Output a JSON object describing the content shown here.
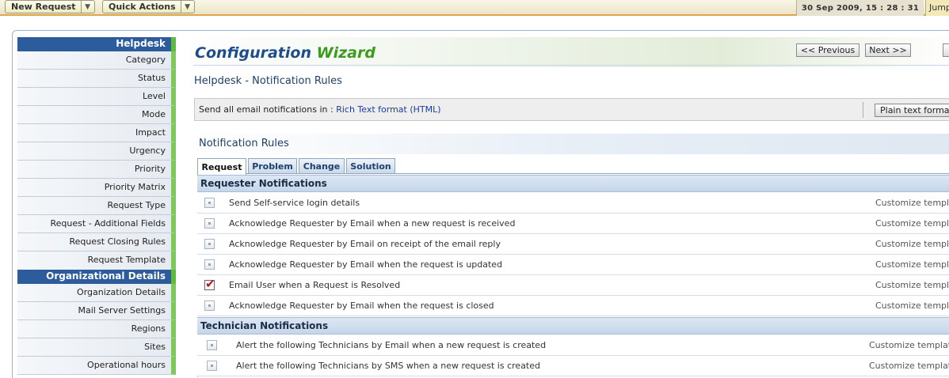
{
  "topbar": {
    "new_request": "New Request",
    "quick_actions": "Quick Actions",
    "datetime": "30 Sep 2009, 15 : 28 : 31",
    "jump": "Jump"
  },
  "sidebar": {
    "groups": [
      {
        "title": "Helpdesk",
        "items": [
          "Category",
          "Status",
          "Level",
          "Mode",
          "Impact",
          "Urgency",
          "Priority",
          "Priority Matrix",
          "Request Type",
          "Request - Additional Fields",
          "Request Closing Rules",
          "Request Template"
        ]
      },
      {
        "title": "Organizational Details",
        "items": [
          "Organization Details",
          "Mail Server Settings",
          "Regions",
          "Sites",
          "Operational hours"
        ]
      }
    ]
  },
  "wizard": {
    "title_part1": "Configuration",
    "title_part2": "Wizard",
    "prev_label": "<< Previous",
    "next_label": "Next >>"
  },
  "page_title": "Helpdesk - Notification Rules",
  "format": {
    "label": "Send all email notifications in : ",
    "value": "Rich Text format (HTML)",
    "plain_button": "Plain text format"
  },
  "rules_heading": "Notification Rules",
  "tabs": [
    "Request",
    "Problem",
    "Change",
    "Solution"
  ],
  "active_tab": "Request",
  "requester": {
    "heading": "Requester Notifications",
    "customize_label": "Customize template",
    "rows": [
      {
        "text": "Send Self-service login details",
        "checked": false
      },
      {
        "text": "Acknowledge Requester by Email when a new request is received",
        "checked": false
      },
      {
        "text": "Acknowledge Requester by Email on receipt of the email reply",
        "checked": false
      },
      {
        "text": "Acknowledge Requester by Email when the request is updated",
        "checked": false
      },
      {
        "text": "Email User when a Request is Resolved",
        "checked": true
      },
      {
        "text": "Acknowledge Requester by Email when the request is closed",
        "checked": false
      }
    ]
  },
  "technician": {
    "heading": "Technician Notifications",
    "customize_label": "Customize template",
    "rows": [
      {
        "text": "Alert the following Technicians by Email when a new request is created",
        "checked": false
      },
      {
        "text": "Alert the following Technicians by SMS when a new request is created",
        "checked": false
      }
    ]
  }
}
